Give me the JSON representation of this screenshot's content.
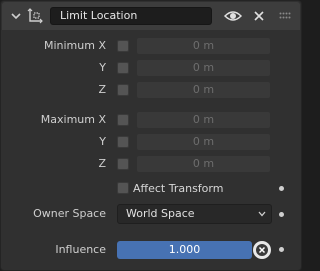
{
  "header": {
    "constraint_name": "Limit Location",
    "icons": [
      "chevron-down-icon",
      "constraint-icon",
      "eye-icon",
      "close-icon",
      "drag-grip-icon"
    ]
  },
  "minimum": {
    "x": {
      "label": "Minimum X",
      "value": "0 m"
    },
    "y": {
      "label": "Y",
      "value": "0 m"
    },
    "z": {
      "label": "Z",
      "value": "0 m"
    }
  },
  "maximum": {
    "x": {
      "label": "Maximum X",
      "value": "0 m"
    },
    "y": {
      "label": "Y",
      "value": "0 m"
    },
    "z": {
      "label": "Z",
      "value": "0 m"
    }
  },
  "affect_transform": {
    "label": "Affect Transform",
    "checked": false
  },
  "owner_space": {
    "label": "Owner Space",
    "value": "World Space"
  },
  "influence": {
    "label": "Influence",
    "value": "1.000",
    "fraction": 1.0
  },
  "colors": {
    "accent": "#4772b3",
    "panel": "#303030",
    "header": "#3d3d3d"
  }
}
